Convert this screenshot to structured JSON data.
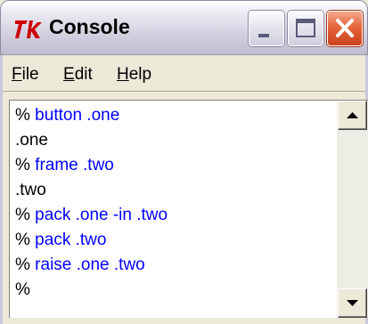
{
  "window": {
    "title": "Console",
    "icon": "tk-feather-icon"
  },
  "controls": {
    "minimize": "minimize-icon",
    "maximize": "maximize-icon",
    "close": "close-icon"
  },
  "menubar": {
    "items": [
      {
        "mnemonic": "F",
        "rest": "ile"
      },
      {
        "mnemonic": "E",
        "rest": "dit"
      },
      {
        "mnemonic": "H",
        "rest": "elp"
      }
    ]
  },
  "console": {
    "lines": [
      {
        "prompt": "%",
        "text": " button .one"
      },
      {
        "prompt": "",
        "text": ".one"
      },
      {
        "prompt": "%",
        "text": " frame .two"
      },
      {
        "prompt": "",
        "text": ".two"
      },
      {
        "prompt": "%",
        "text": " pack .one -in .two"
      },
      {
        "prompt": "%",
        "text": " pack .two"
      },
      {
        "prompt": "%",
        "text": " raise .one .two"
      },
      {
        "prompt": "%",
        "text": ""
      }
    ]
  },
  "colors": {
    "command": "#0000ff",
    "output": "#000000",
    "title_icon": "#cc0000"
  }
}
